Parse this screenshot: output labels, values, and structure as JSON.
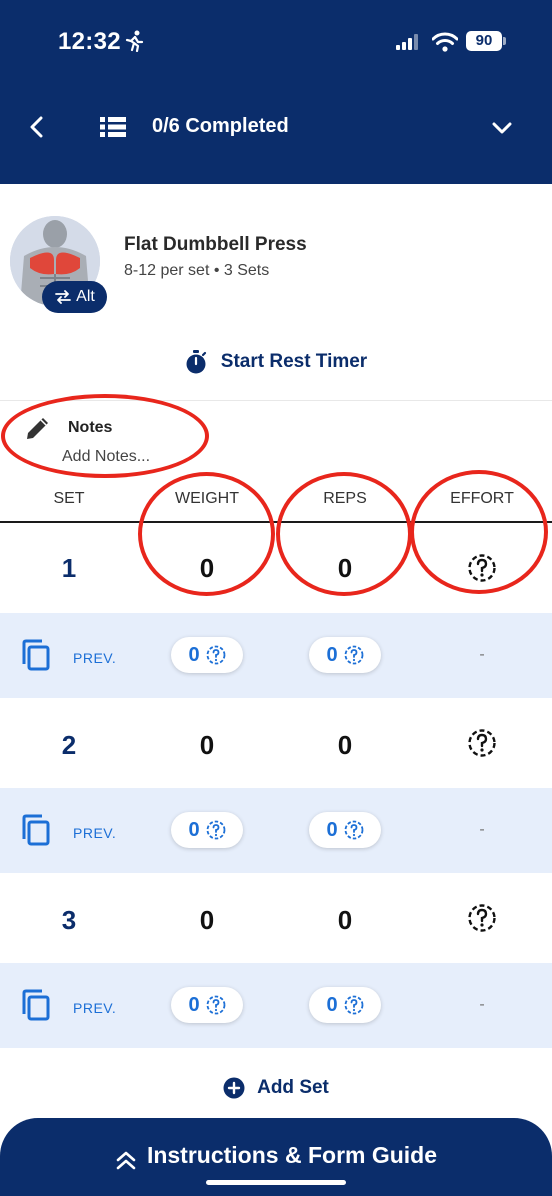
{
  "status_bar": {
    "time": "12:32",
    "battery": "90"
  },
  "header": {
    "progress": "0/6 Completed"
  },
  "exercise": {
    "name": "Flat Dumbbell Press",
    "details": "8-12 per set • 3 Sets",
    "alt_label": "Alt"
  },
  "timer": {
    "label": "Start Rest Timer"
  },
  "notes": {
    "title": "Notes",
    "placeholder": "Add Notes..."
  },
  "columns": {
    "set": "SET",
    "weight": "WEIGHT",
    "reps": "REPS",
    "effort": "EFFORT"
  },
  "sets": [
    {
      "number": "1",
      "weight": "0",
      "reps": "0"
    },
    {
      "number": "2",
      "weight": "0",
      "reps": "0"
    },
    {
      "number": "3",
      "weight": "0",
      "reps": "0"
    }
  ],
  "previous": [
    {
      "label": "PREV.",
      "weight": "0",
      "reps": "0",
      "effort": "-"
    },
    {
      "label": "PREV.",
      "weight": "0",
      "reps": "0",
      "effort": "-"
    },
    {
      "label": "PREV.",
      "weight": "0",
      "reps": "0",
      "effort": "-"
    }
  ],
  "add_set": {
    "label": "Add Set"
  },
  "guide": {
    "label": "Instructions & Form Guide"
  },
  "colors": {
    "brand": "#0b2d6b",
    "accent": "#1c6fd6",
    "prev_bg": "#e6eefb",
    "annotation": "#e8261c"
  }
}
